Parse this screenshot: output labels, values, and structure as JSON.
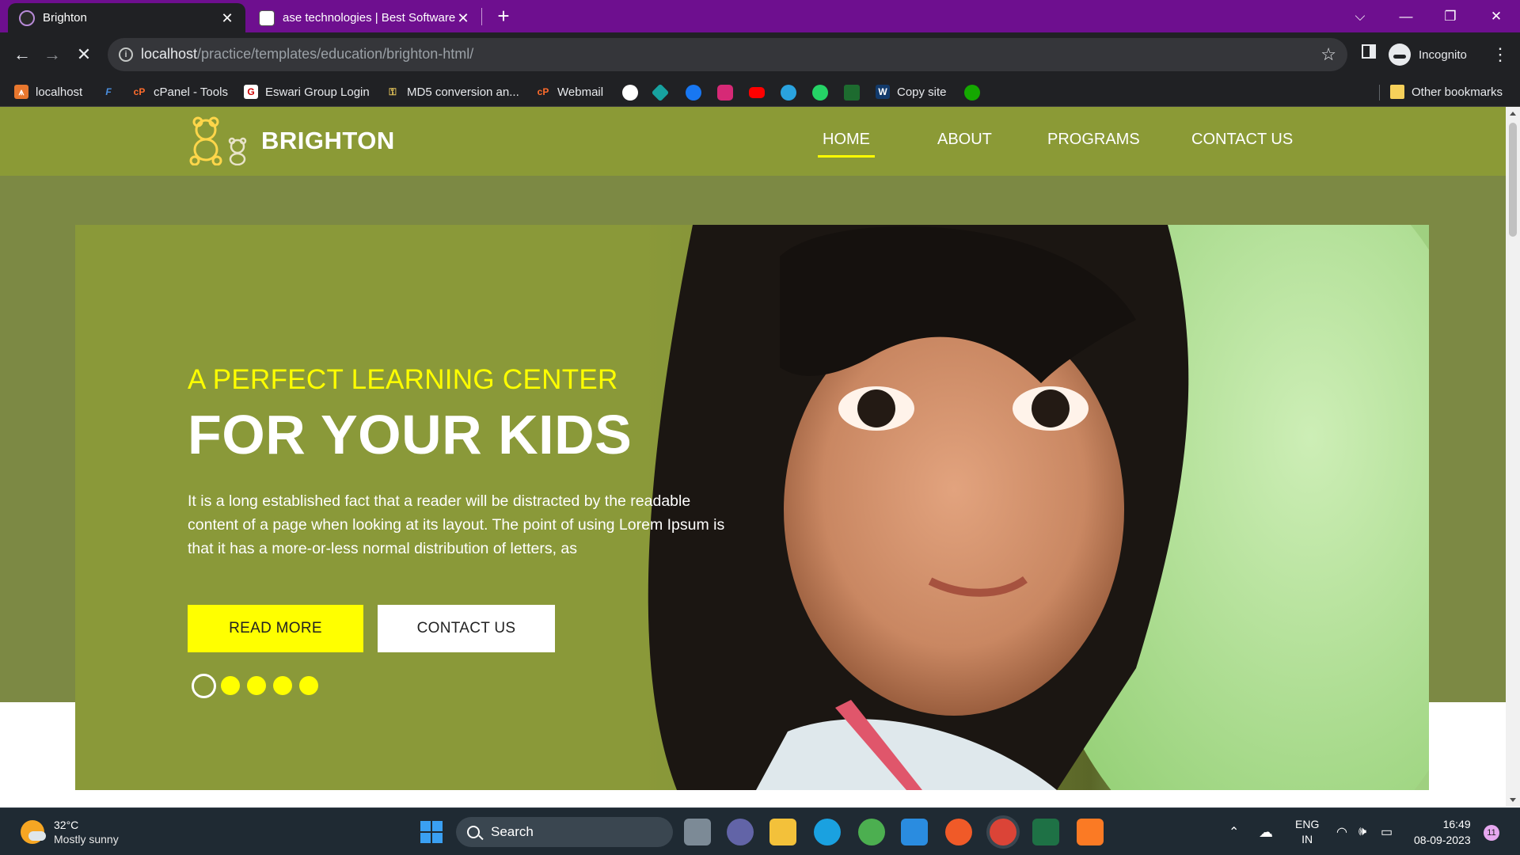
{
  "browser": {
    "tabs": [
      {
        "title": "Brighton",
        "active": true,
        "icon": "brighton-favicon"
      },
      {
        "title": "ase technologies | Best Software",
        "active": false,
        "icon": "ase-favicon"
      }
    ],
    "new_tab_glyph": "+",
    "address": {
      "host": "localhost",
      "path": "/practice/templates/education/brighton-html/"
    },
    "profile_label": "Incognito",
    "bookmarks": [
      {
        "label": "localhost",
        "icon": "xampp-icon"
      },
      {
        "label": "cPanel - Tools",
        "icon": "cpanel-icon"
      },
      {
        "label": "Eswari Group Login",
        "icon": "eswari-icon"
      },
      {
        "label": "MD5 conversion an...",
        "icon": "key-icon"
      },
      {
        "label": "Webmail",
        "icon": "cpanel-icon"
      },
      {
        "label": "Copy site",
        "icon": "copy-site-icon"
      }
    ],
    "other_bookmarks": "Other bookmarks"
  },
  "site": {
    "brand": "BRIGHTON",
    "nav": [
      {
        "label": "HOME",
        "active": true
      },
      {
        "label": "ABOUT",
        "active": false
      },
      {
        "label": "PROGRAMS",
        "active": false
      },
      {
        "label": "CONTACT US",
        "active": false
      }
    ],
    "hero": {
      "subtitle": "A PERFECT LEARNING CENTER",
      "title": "FOR YOUR KIDS",
      "text": "It is a long established fact that a reader will be distracted by the readable content of a page when looking at its layout. The point of using Lorem Ipsum is that it has a more-or-less normal distribution of letters, as",
      "primary_button": "READ MORE",
      "secondary_button": "CONTACT US",
      "slides": 5,
      "active_slide": 1
    }
  },
  "taskbar": {
    "weather": {
      "temp": "32°C",
      "condition": "Mostly sunny"
    },
    "search_placeholder": "Search",
    "language": {
      "line1": "ENG",
      "line2": "IN"
    },
    "time": "16:49",
    "date": "08-09-2023",
    "notifications": "11"
  },
  "colors": {
    "header": "#8b9a36",
    "hero_band": "#7c8944",
    "accent": "#ffff00",
    "tabbar": "#6e0f8f"
  }
}
